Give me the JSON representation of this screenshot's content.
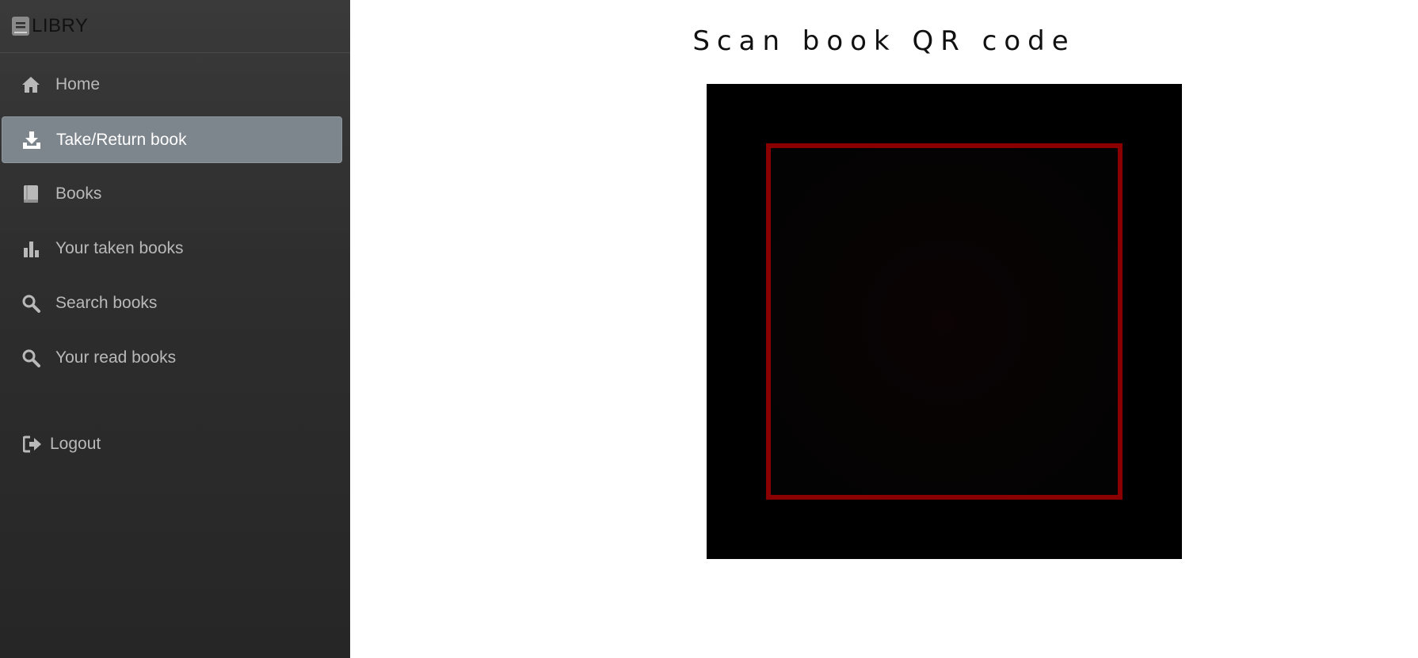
{
  "brand": {
    "name": "LIBRY",
    "icon": "book-icon"
  },
  "sidebar": {
    "items": [
      {
        "label": "Home",
        "icon": "home-icon",
        "active": false
      },
      {
        "label": "Take/Return book",
        "icon": "download-icon",
        "active": true
      },
      {
        "label": "Books",
        "icon": "book-icon",
        "active": false
      },
      {
        "label": "Your taken books",
        "icon": "bar-chart-icon",
        "active": false
      },
      {
        "label": "Search books",
        "icon": "search-icon",
        "active": false
      },
      {
        "label": "Your read books",
        "icon": "search-icon",
        "active": false
      }
    ],
    "logout": {
      "label": "Logout",
      "icon": "sign-out-icon"
    }
  },
  "main": {
    "title": "Scan book QR code"
  },
  "colors": {
    "sidebar_top": "#3a3a3a",
    "sidebar_bottom": "#262626",
    "active_item": "#7e868d",
    "scan_frame": "#8a0000",
    "scanner_bg": "#000000"
  }
}
